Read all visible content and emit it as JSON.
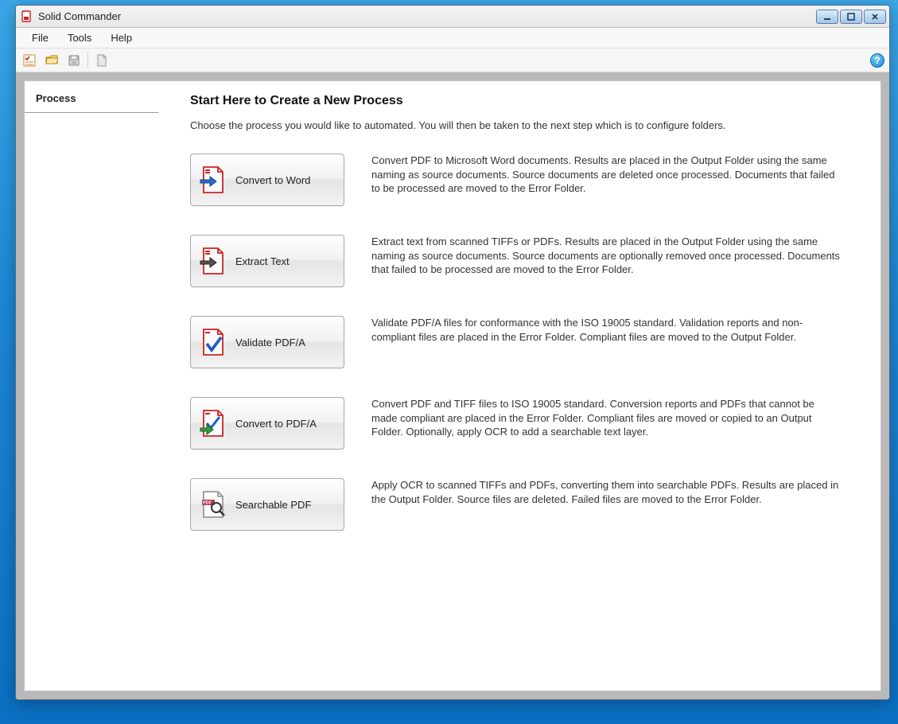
{
  "window": {
    "title": "Solid Commander"
  },
  "menubar": {
    "items": [
      "File",
      "Tools",
      "Help"
    ]
  },
  "toolbar": {
    "help_glyph": "?"
  },
  "sidebar": {
    "items": [
      {
        "label": "Process"
      }
    ]
  },
  "main": {
    "heading": "Start Here to Create a New Process",
    "subtitle": "Choose the process you would like to automated. You will then be taken to the next step which is to configure folders.",
    "processes": [
      {
        "label": "Convert to Word",
        "description": "Convert PDF to Microsoft Word documents. Results are placed in the Output Folder using the same naming as source documents. Source documents are deleted once processed. Documents that failed to be processed are moved to the Error Folder."
      },
      {
        "label": "Extract Text",
        "description": "Extract text from scanned TIFFs or PDFs. Results are placed in the Output Folder using the same naming as source documents. Source documents are optionally removed once processed. Documents that failed to be processed are moved to the Error Folder."
      },
      {
        "label": "Validate PDF/A",
        "description": "Validate PDF/A files for conformance with the ISO 19005 standard. Validation reports and non-compliant files are placed in the Error Folder. Compliant files are moved to the Output Folder."
      },
      {
        "label": "Convert to PDF/A",
        "description": "Convert PDF and TIFF files to ISO 19005 standard. Conversion reports and PDFs that cannot be made compliant are placed in the Error Folder. Compliant files are moved or copied to an Output Folder. Optionally, apply OCR to add a searchable text layer."
      },
      {
        "label": "Searchable PDF",
        "description": "Apply OCR to scanned TIFFs and PDFs, converting them into searchable PDFs. Results are placed in the Output Folder. Source files are deleted. Failed files are moved to the Error Folder."
      }
    ]
  }
}
